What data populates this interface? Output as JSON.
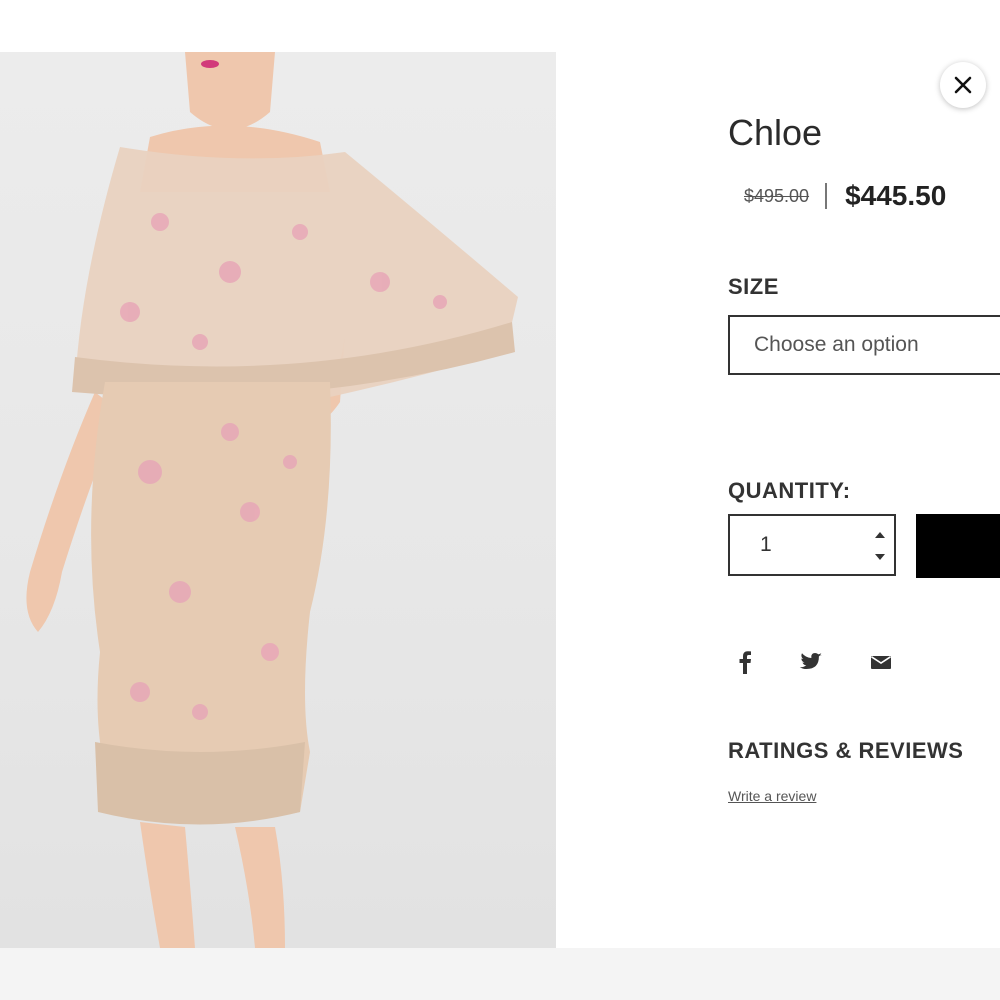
{
  "product": {
    "title": "Chloe",
    "old_price": "$495.00",
    "new_price": "$445.50",
    "image_icon": "dress-photo"
  },
  "size": {
    "label": "SIZE",
    "placeholder": "Choose an option"
  },
  "quantity": {
    "label": "QUANTITY:",
    "value": "1"
  },
  "share": {
    "icons": [
      "facebook-icon",
      "twitter-icon",
      "email-icon"
    ]
  },
  "reviews": {
    "heading": "RATINGS & REVIEWS",
    "write_link": "Write a review"
  },
  "colors": {
    "button_black": "#000000",
    "text_dark": "#222222",
    "photo_bg": "#e9e9e9",
    "dress_nude": "#e6cbb3",
    "embroidery_pink": "#e7a7b7"
  }
}
